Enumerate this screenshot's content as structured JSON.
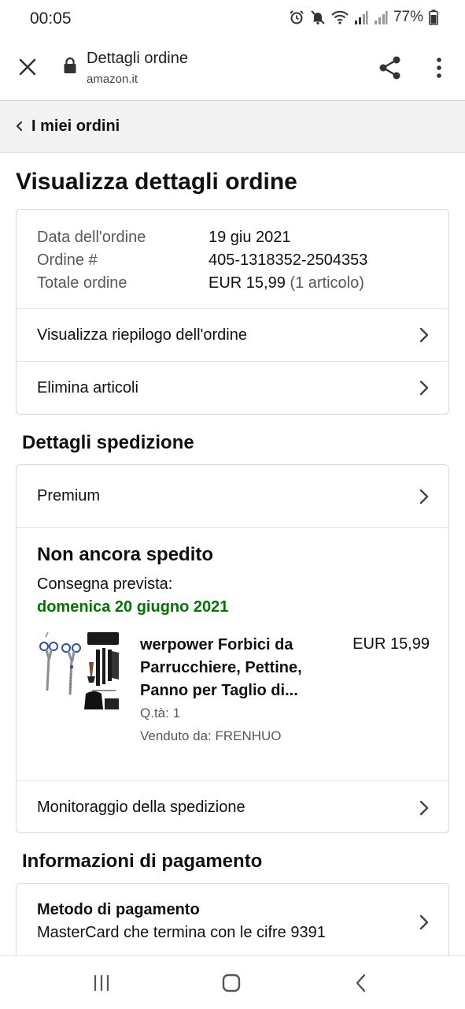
{
  "status_bar": {
    "time": "00:05",
    "battery": "77%"
  },
  "browser": {
    "title": "Dettagli ordine",
    "url": "amazon.it",
    "icons": [
      "close-icon",
      "lock-icon",
      "share-icon",
      "more-vert-icon"
    ]
  },
  "breadcrumb": {
    "label": "I miei ordini"
  },
  "page": {
    "heading": "Visualizza dettagli ordine"
  },
  "order_summary": {
    "date_label": "Data dell'ordine",
    "date_value": "19 giu 2021",
    "number_label": "Ordine #",
    "number_value": "405-1318352-2504353",
    "total_label": "Totale ordine",
    "total_value": "EUR 15,99",
    "total_items": "(1 articolo)",
    "links": {
      "view_summary": "Visualizza riepilogo dell'ordine",
      "delete_items": "Elimina articoli"
    }
  },
  "shipping": {
    "heading": "Dettagli spedizione",
    "method": "Premium",
    "status": "Non ancora spedito",
    "delivery_label": "Consegna prevista:",
    "delivery_date": "domenica 20 giugno 2021",
    "item": {
      "title": "werpower Forbici da Parrucchiere, Pettine, Panno per Taglio di...",
      "price": "EUR 15,99",
      "quantity": "Q.tà: 1",
      "seller": "Venduto da: FRENHUO"
    },
    "tracking_link": "Monitoraggio della spedizione"
  },
  "payment": {
    "heading": "Informazioni di pagamento",
    "method_title": "Metodo di pagamento",
    "method_detail": "MasterCard che termina con le cifre 9391"
  },
  "colors": {
    "delivery_green": "#007600",
    "text": "#0f1111",
    "muted": "#565959",
    "border": "#d5d9d9",
    "breadcrumb_bg": "#f3f3f3"
  }
}
